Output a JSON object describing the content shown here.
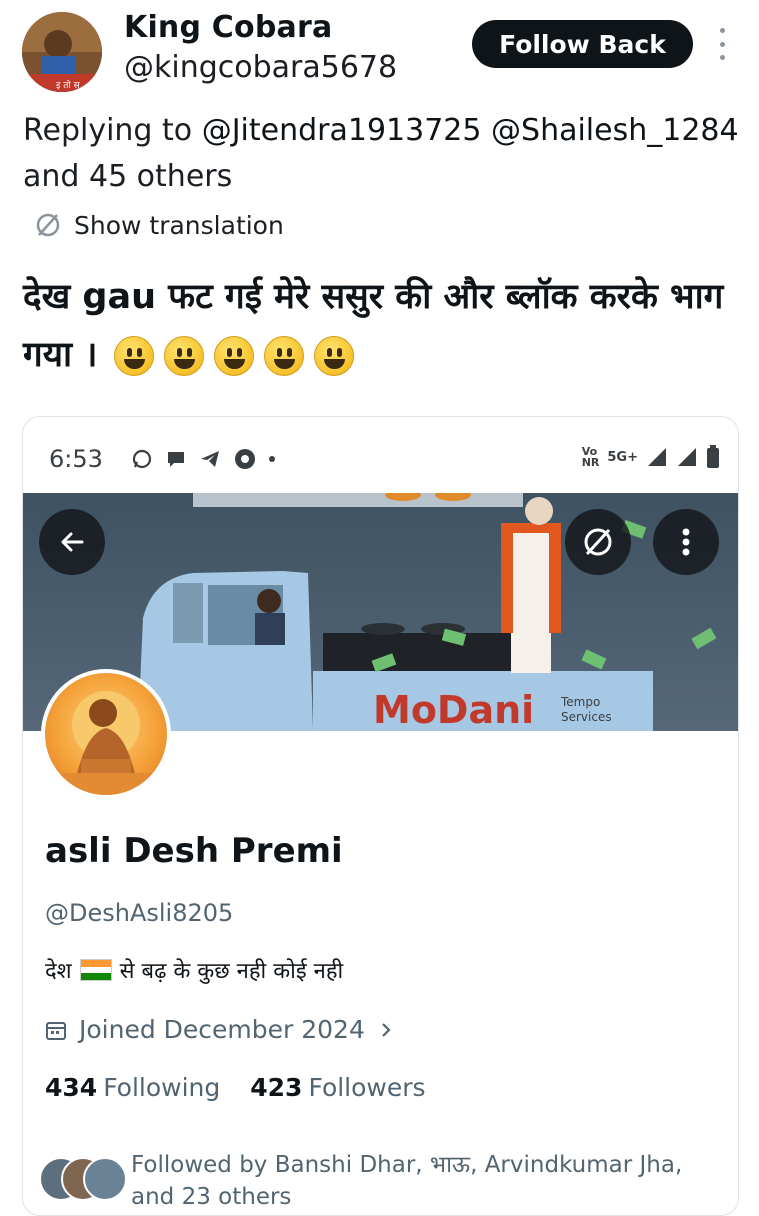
{
  "tweet": {
    "author_name": "King Cobara",
    "author_handle": "@kingcobara5678",
    "avatar_caption": "इ तो स",
    "follow_back_label": "Follow Back",
    "replying_prefix": "Replying to",
    "mention_1": "@Jitendra1913725",
    "mention_2": "@Shailesh_1284",
    "replying_suffix": "and 45 others",
    "show_translation_label": "Show translation",
    "text": "देख gau फट गई मेरे ससुर की और ब्लॉक करके भाग गया ।",
    "emoji_count": 5
  },
  "embedded_screenshot": {
    "status_bar": {
      "time": "6:53",
      "network_label_top": "Vo",
      "network_label_bottom": "NR",
      "network_type": "5G+"
    },
    "banner": {
      "brand_text": "MoDani",
      "brand_sub_1": "Tempo",
      "brand_sub_2": "Services"
    },
    "profile": {
      "display_name": "asli Desh Premi",
      "handle": "@DeshAsli8205",
      "bio_before_flag": "देश",
      "bio_after_flag": "से बढ़ के कुछ नही कोई नही",
      "joined": "Joined December 2024",
      "following_count": "434",
      "following_label": "Following",
      "followers_count": "423",
      "followers_label": "Followers",
      "followed_by_text": "Followed by Banshi Dhar, भाऊ, Arvindkumar Jha, and 23 others"
    }
  },
  "colors": {
    "primary_text": "#0f1419",
    "secondary_text": "#536471",
    "button_bg": "#0f1419",
    "banner_bg": "#4a5e6e",
    "modani_red": "#c0392b"
  },
  "icons": [
    "more-vertical-icon",
    "translate-icon",
    "back-arrow-icon",
    "translate-icon",
    "more-vertical-icon",
    "calendar-icon",
    "chevron-right-icon"
  ]
}
